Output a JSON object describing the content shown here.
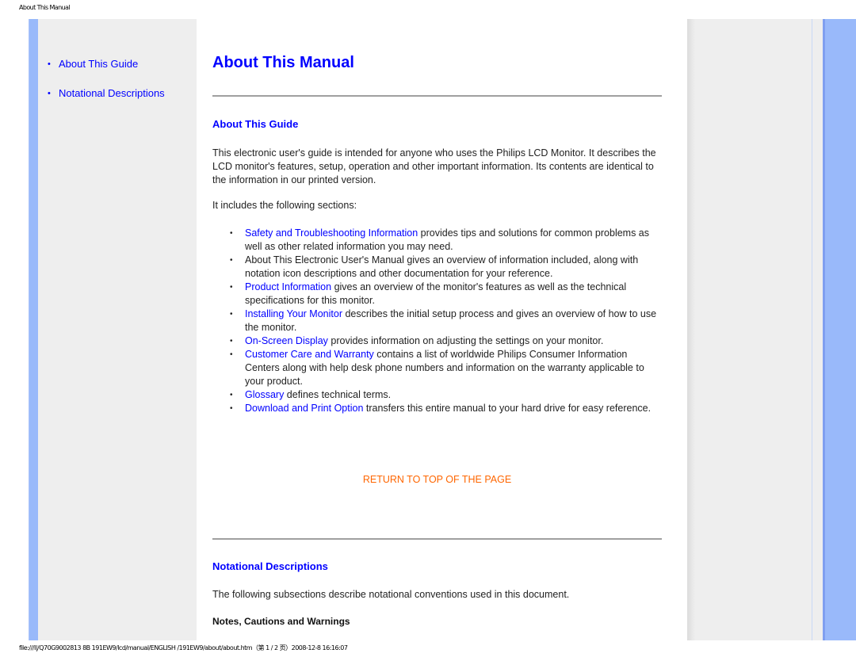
{
  "page_header": "About This Manual",
  "page_footer": "file:///I|/Q70G9002813 8B 191EW9/lcd/manual/ENGLISH /191EW9/about/about.htm（第 1 / 2 页）2008-12-8 16:16:07",
  "left_nav": [
    {
      "label": "About This Guide"
    },
    {
      "label": "Notational Descriptions"
    }
  ],
  "main": {
    "title": "About This Manual",
    "section1": {
      "heading": "About This Guide",
      "intro": "This electronic user's guide is intended for anyone who uses the Philips LCD Monitor. It describes the LCD monitor's features, setup, operation and other important information. Its contents are identical to the information in our printed version.",
      "includes": "It includes the following sections:",
      "items": [
        {
          "link": "Safety and Troubleshooting Information",
          "text": " provides tips and solutions for common problems as well as other related information you may need."
        },
        {
          "link": "",
          "text": "About This Electronic User's Manual gives an overview of information included, along with notation icon descriptions and other documentation for your reference."
        },
        {
          "link": "Product Information",
          "text": " gives an overview of the monitor's features as well as the technical specifications for this monitor."
        },
        {
          "link": "Installing Your Monitor",
          "text": " describes the initial setup process and gives an overview of how to use the monitor."
        },
        {
          "link": "On-Screen Display",
          "text": " provides information on adjusting the settings on your monitor."
        },
        {
          "link": "Customer Care and Warranty",
          "text": " contains a list of worldwide Philips Consumer Information Centers along with help desk phone numbers and information on the warranty applicable to your product."
        },
        {
          "link": "Glossary",
          "text": " defines technical terms."
        },
        {
          "link": "Download and Print Option",
          "text": " transfers this entire manual to your hard drive for easy reference."
        }
      ],
      "return_link": "RETURN TO TOP OF THE PAGE"
    },
    "section2": {
      "heading": "Notational Descriptions",
      "intro": "The following subsections describe notational conventions used in this document.",
      "subheading": "Notes, Cautions and Warnings"
    }
  },
  "colors": {
    "link": "#0000ff",
    "return_link": "#ff6600",
    "side_band": "#99b9fa",
    "panel": "#eeeeee"
  }
}
